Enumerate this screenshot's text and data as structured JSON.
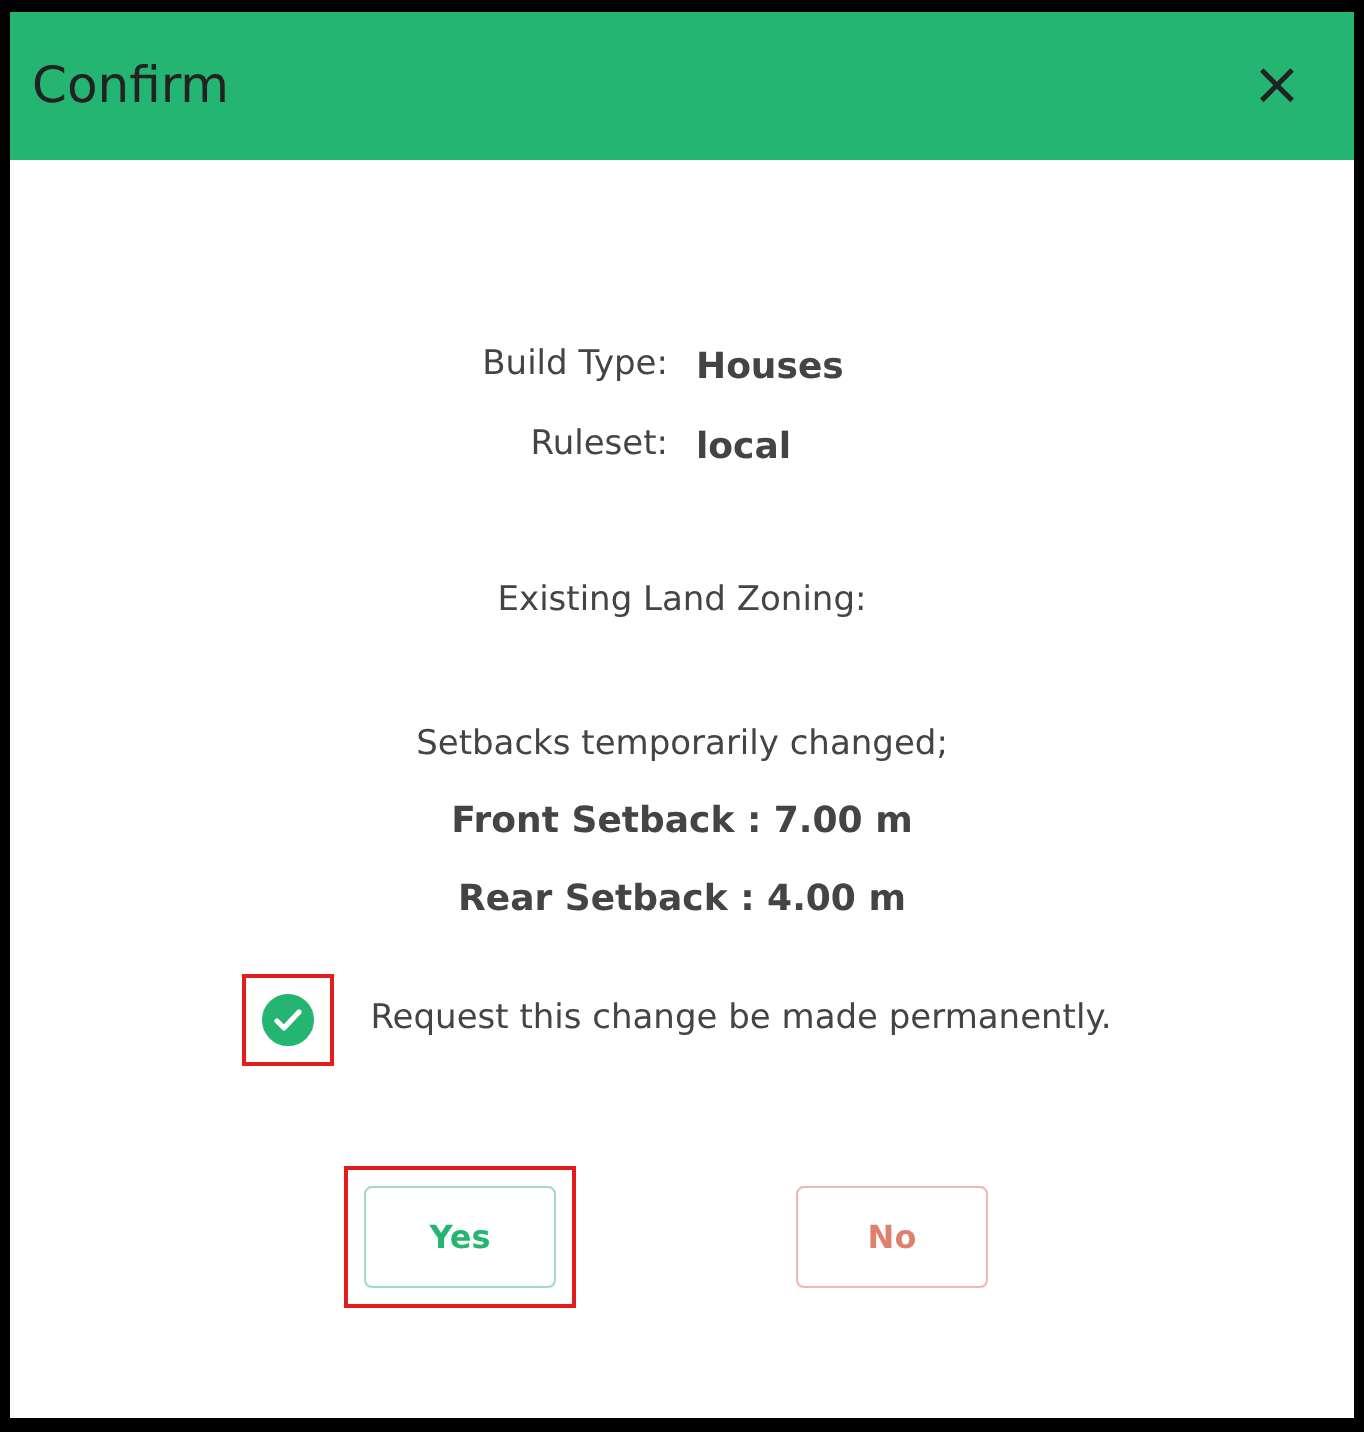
{
  "dialog": {
    "title": "Confirm",
    "close": "×"
  },
  "details": [
    {
      "label": "Build Type:",
      "value": "Houses"
    },
    {
      "label": "Ruleset:",
      "value": "local"
    }
  ],
  "zoning": {
    "label": "Existing Land Zoning:"
  },
  "setbacks": {
    "intro": "Setbacks temporarily changed;",
    "lines": [
      "Front Setback : 7.00 m",
      "Rear Setback : 4.00 m"
    ]
  },
  "permanent": {
    "label": "Request this change be made permanently.",
    "checked": true,
    "highlighted": true
  },
  "buttons": [
    {
      "label": "Yes",
      "kind": "confirm",
      "highlighted": true
    },
    {
      "label": "No",
      "kind": "cancel",
      "highlighted": false
    }
  ]
}
